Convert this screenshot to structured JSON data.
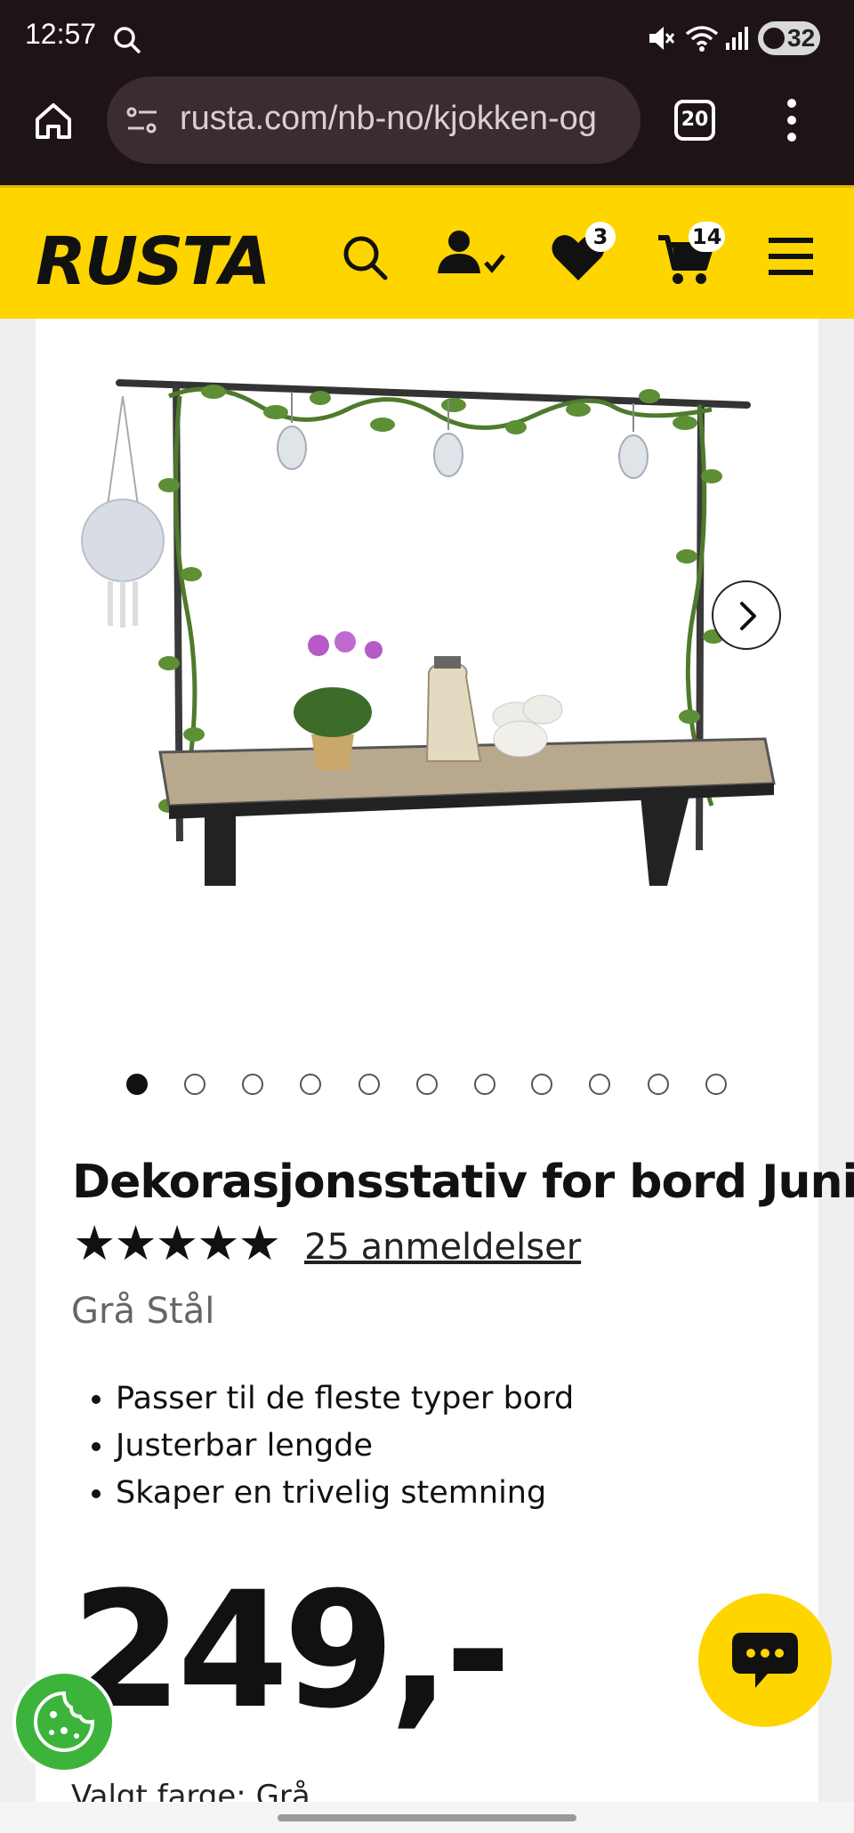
{
  "status_bar": {
    "time": "12:57",
    "battery": "32"
  },
  "browser": {
    "url": "rusta.com/nb-no/kjokken-og",
    "tab_count": "20"
  },
  "header": {
    "logo_text": "RUSTA",
    "wishlist_count": "3",
    "cart_count": "14"
  },
  "gallery": {
    "image_count": 11,
    "active_index": 0
  },
  "product": {
    "title": "Dekorasjonsstativ for bord Juni",
    "stars": "★★★★★",
    "reviews": "25 anmeldelser",
    "variant": "Grå Stål",
    "bullets": [
      "Passer til de fleste typer bord",
      "Justerbar lengde",
      "Skaper en trivelig stemning"
    ],
    "price": "249,-",
    "selected_color": "Valgt farge: Grå"
  },
  "colors": {
    "brand_yellow": "#ffd500",
    "cookie_green": "#3cb43c",
    "browser_dark": "#1e1416"
  }
}
